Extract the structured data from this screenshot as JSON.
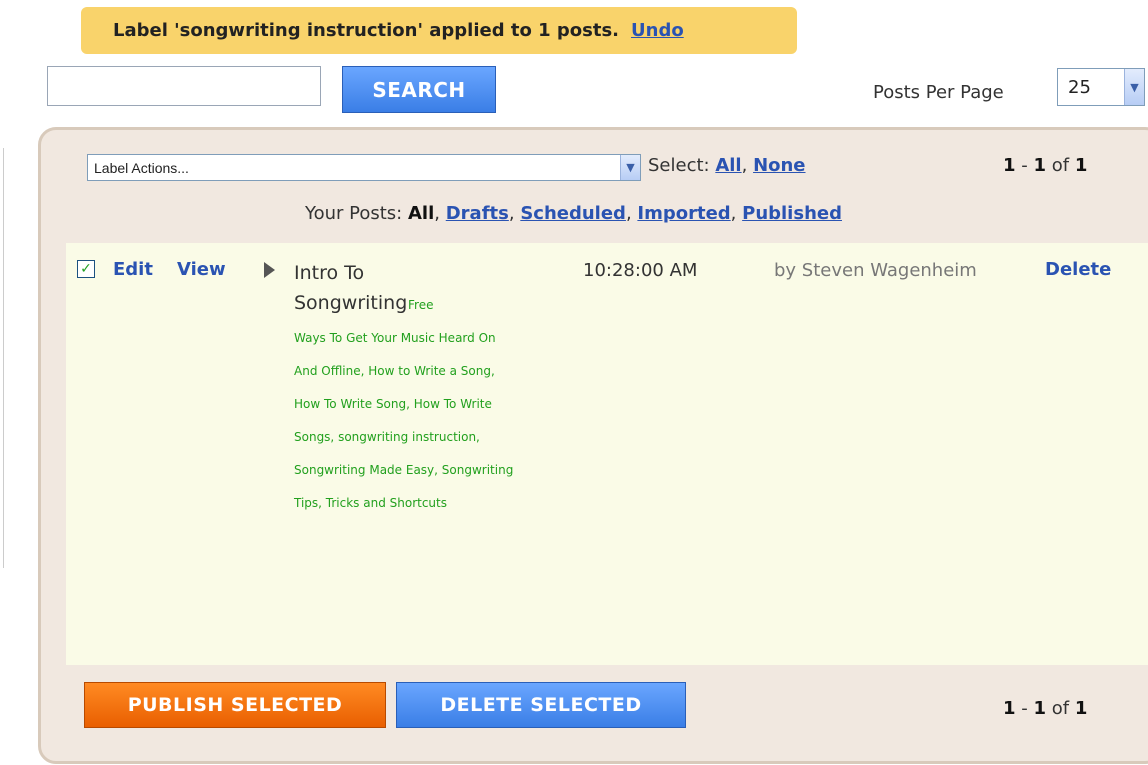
{
  "notice": {
    "message": "Label 'songwriting instruction' applied to 1 posts.",
    "undo_label": "Undo"
  },
  "search": {
    "value": "",
    "button_label": "SEARCH"
  },
  "posts_per_page": {
    "label": "Posts Per Page",
    "selected": "25"
  },
  "toolbar": {
    "label_actions": "Label Actions...",
    "select_label": "Select:",
    "select_all": "All",
    "select_none": "None",
    "pager": {
      "start": "1",
      "sep": " - ",
      "end": "1",
      "of": " of ",
      "total": "1"
    }
  },
  "tabs": {
    "prefix": "Your Posts:",
    "items": [
      {
        "label": "All",
        "current": true
      },
      {
        "label": "Drafts"
      },
      {
        "label": "Scheduled"
      },
      {
        "label": "Imported"
      },
      {
        "label": "Published"
      }
    ]
  },
  "posts": [
    {
      "checked": true,
      "edit_label": "Edit",
      "view_label": "View",
      "title_line1": "Intro To",
      "title_line2": "Songwriting",
      "labels_first": "Free",
      "labels_rest": "Ways To Get Your Music Heard On And Offline, How to Write a Song, How To Write Song, How To Write Songs, songwriting instruction, Songwriting Made Easy, Songwriting Tips, Tricks and Shortcuts",
      "time": "10:28:00 AM",
      "author": "by Steven Wagenheim",
      "delete_label": "Delete"
    }
  ],
  "footer": {
    "publish_label": "PUBLISH SELECTED",
    "delete_label": "DELETE SELECTED"
  },
  "colors": {
    "notice_bg": "#f9d36b",
    "link": "#2a53b2",
    "label_green": "#22a01e",
    "publish_orange": "#ff7a10",
    "button_blue": "#4a8cf0",
    "panel_bg": "#f1e8e0",
    "row_bg": "#fafbe7"
  }
}
